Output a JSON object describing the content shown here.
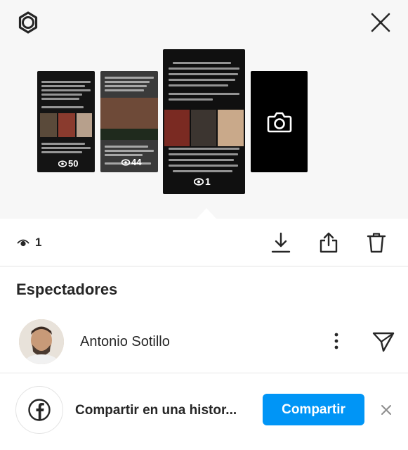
{
  "story": {
    "views_label": "1",
    "thumbnails": [
      {
        "views": "50"
      },
      {
        "views": "44"
      },
      {
        "views": "1"
      },
      {
        "type": "camera"
      }
    ]
  },
  "toolbar": {
    "icons": [
      "download-icon",
      "share-icon",
      "trash-icon"
    ]
  },
  "viewers": {
    "title": "Espectadores",
    "items": [
      {
        "name": "Antonio Sotillo"
      }
    ]
  },
  "share": {
    "text": "Compartir en una histor...",
    "button_label": "Compartir"
  },
  "colors": {
    "accent": "#0095f6",
    "text": "#262626",
    "top_background": "#f7f7f7"
  }
}
